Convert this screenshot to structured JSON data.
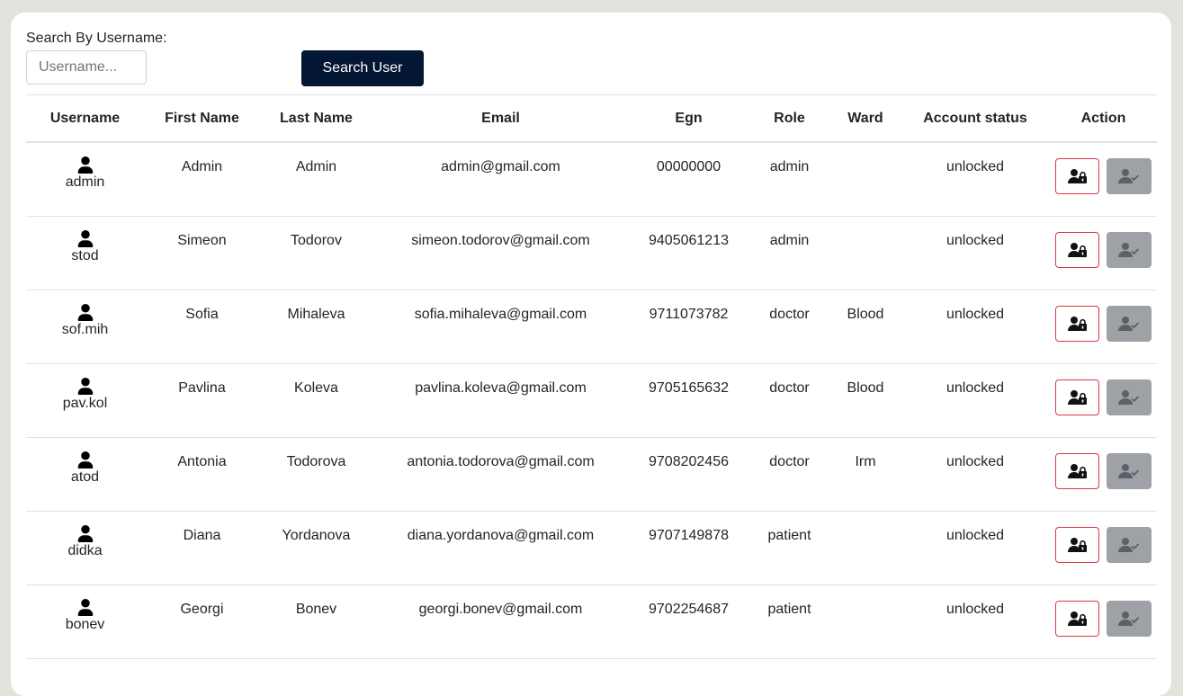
{
  "search": {
    "label": "Search By Username:",
    "placeholder": "Username...",
    "value": "",
    "button_label": "Search User"
  },
  "table": {
    "headers": {
      "username": "Username",
      "first_name": "First Name",
      "last_name": "Last Name",
      "email": "Email",
      "egn": "Egn",
      "role": "Role",
      "ward": "Ward",
      "account_status": "Account status",
      "action": "Action"
    },
    "rows": [
      {
        "username": "admin",
        "first_name": "Admin",
        "last_name": "Admin",
        "email": "admin@gmail.com",
        "egn": "00000000",
        "role": "admin",
        "ward": "",
        "account_status": "unlocked"
      },
      {
        "username": "stod",
        "first_name": "Simeon",
        "last_name": "Todorov",
        "email": "simeon.todorov@gmail.com",
        "egn": "9405061213",
        "role": "admin",
        "ward": "",
        "account_status": "unlocked"
      },
      {
        "username": "sof.mih",
        "first_name": "Sofia",
        "last_name": "Mihaleva",
        "email": "sofia.mihaleva@gmail.com",
        "egn": "9711073782",
        "role": "doctor",
        "ward": "Blood",
        "account_status": "unlocked"
      },
      {
        "username": "pav.kol",
        "first_name": "Pavlina",
        "last_name": "Koleva",
        "email": "pavlina.koleva@gmail.com",
        "egn": "9705165632",
        "role": "doctor",
        "ward": "Blood",
        "account_status": "unlocked"
      },
      {
        "username": "atod",
        "first_name": "Antonia",
        "last_name": "Todorova",
        "email": "antonia.todorova@gmail.com",
        "egn": "9708202456",
        "role": "doctor",
        "ward": "Irm",
        "account_status": "unlocked"
      },
      {
        "username": "didka",
        "first_name": "Diana",
        "last_name": "Yordanova",
        "email": "diana.yordanova@gmail.com",
        "egn": "9707149878",
        "role": "patient",
        "ward": "",
        "account_status": "unlocked"
      },
      {
        "username": "bonev",
        "first_name": "Georgi",
        "last_name": "Bonev",
        "email": "georgi.bonev@gmail.com",
        "egn": "9702254687",
        "role": "patient",
        "ward": "",
        "account_status": "unlocked"
      }
    ]
  },
  "icons": {
    "user": "user-icon",
    "lock_action": "user-lock-icon",
    "unlock_action": "user-check-icon"
  },
  "colors": {
    "search_button_bg": "#031633",
    "lock_button_border": "#dc3545",
    "unlock_button_bg": "#9ea1a5"
  }
}
